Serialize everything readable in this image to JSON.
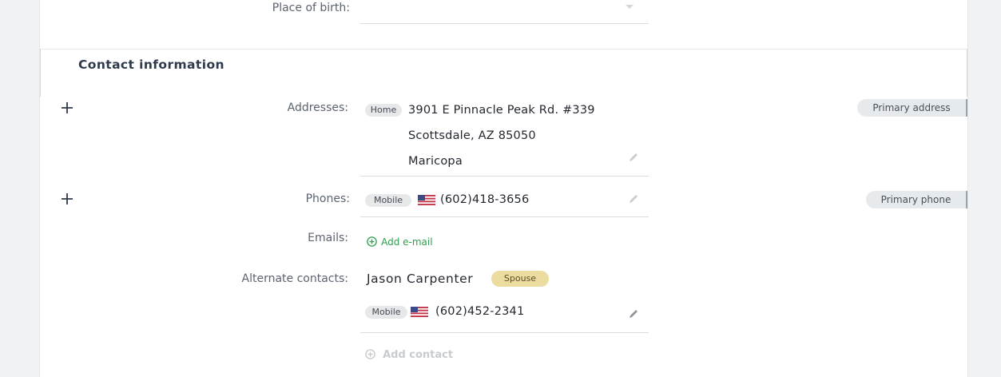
{
  "personal": {
    "place_of_birth_label": "Place of birth:",
    "place_of_birth_value": ""
  },
  "contact": {
    "section_title": "Contact information",
    "addresses_label": "Addresses:",
    "address": {
      "type": "Home",
      "line1": "3901 E Pinnacle Peak Rd. #339",
      "line2": "Scottsdale, AZ 85050",
      "line3": "Maricopa"
    },
    "primary_address_badge": "Primary address",
    "phones_label": "Phones:",
    "phone": {
      "type": "Mobile",
      "number": "(602)418-3656"
    },
    "primary_phone_badge": "Primary phone",
    "emails_label": "Emails:",
    "add_email_label": "Add e-mail",
    "alternate_contacts_label": "Alternate contacts:",
    "alternate_contact": {
      "name": "Jason Carpenter",
      "relation": "Spouse",
      "phone_type": "Mobile",
      "phone_number": "(602)452-2341"
    },
    "add_contact_label": "Add contact"
  },
  "colors": {
    "accent_green": "#2e9e4f",
    "spouse_badge_bg": "#ecdca0",
    "heading": "#2f3a4d",
    "muted": "#c3c7cc"
  }
}
